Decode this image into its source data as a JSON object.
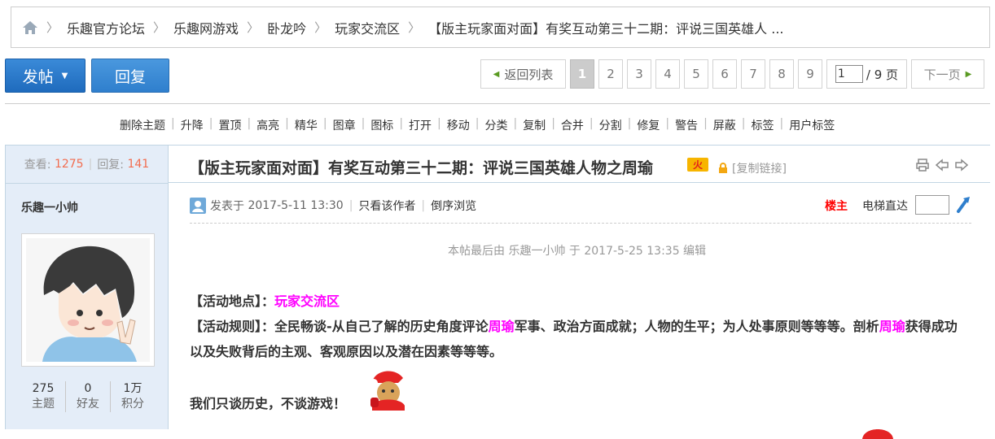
{
  "breadcrumb": {
    "items": [
      "乐趣官方论坛",
      "乐趣网游戏",
      "卧龙吟",
      "玩家交流区",
      "【版主玩家面对面】有奖互动第三十二期：评说三国英雄人 ..."
    ]
  },
  "toolbar": {
    "post_label": "发帖",
    "reply_label": "回复"
  },
  "pager": {
    "back_label": "返回列表",
    "pages": [
      "1",
      "2",
      "3",
      "4",
      "5",
      "6",
      "7",
      "8",
      "9"
    ],
    "current_page": "1",
    "page_input_value": "1",
    "total_label": "/ 9 页",
    "next_label": "下一页"
  },
  "mod_actions": [
    "删除主题",
    "升降",
    "置顶",
    "高亮",
    "精华",
    "图章",
    "图标",
    "打开",
    "移动",
    "分类",
    "复制",
    "合并",
    "分割",
    "修复",
    "警告",
    "屏蔽",
    "标签",
    "用户标签"
  ],
  "thread_stats": {
    "views_label": "查看:",
    "views": "1275",
    "replies_label": "回复:",
    "replies": "141"
  },
  "author": {
    "name": "乐趣一小帅",
    "topics": "275",
    "topics_label": "主题",
    "friends": "0",
    "friends_label": "好友",
    "points": "1万",
    "points_label": "积分"
  },
  "post": {
    "title": "【版主玩家面对面】有奖互动第三十二期：评说三国英雄人物之周瑜",
    "hot_badge": "火",
    "copy_link_label": "[复制链接]",
    "posted_prefix": "发表于",
    "posted_time": "2017-5-11 13:30",
    "only_author_label": "只看该作者",
    "reverse_label": "倒序浏览",
    "floor_label": "楼主",
    "elevator_label": "电梯直达",
    "edit_note": "本帖最后由 乐趣一小帅 于 2017-5-25 13:35 编辑",
    "line1_prefix": "【活动地点】：",
    "line1_link": "玩家交流区",
    "line2_a": "【活动规则】：全民畅谈-从自己了解的历史角度评论",
    "line2_hl1": "周瑜",
    "line2_b": "军事、政治方面成就；人物的生平；为人处事原则等等等。剖析",
    "line2_hl2": "周瑜",
    "line2_c": "获得成功以及失败背后的主观、客观原因以及潜在因素等等等。",
    "line3": "我们只谈历史，不谈游戏！"
  },
  "colors": {
    "accent_blue": "#2f7fcd",
    "link_pink": "#ff00ff",
    "stat_orange": "#f26c4f",
    "floor_red": "#ff0000"
  }
}
